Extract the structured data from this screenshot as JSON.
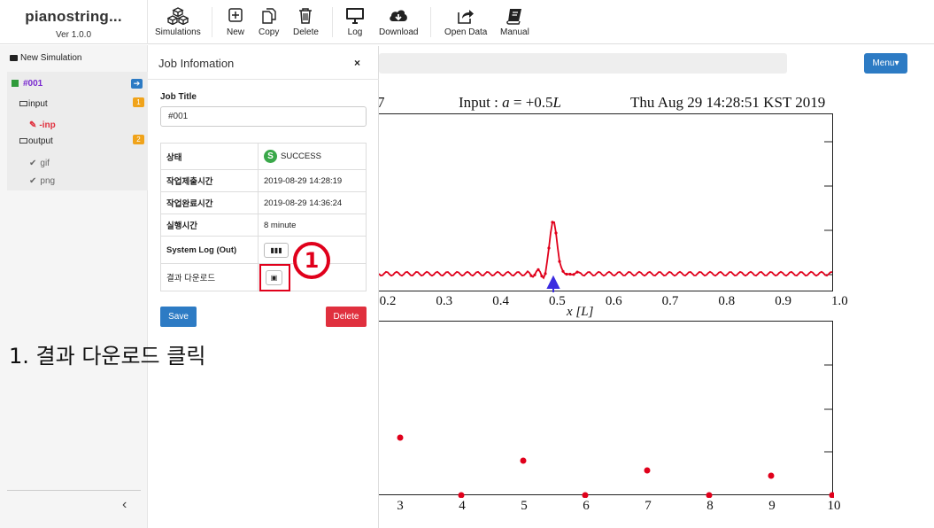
{
  "app": {
    "name": "pianostring...",
    "version": "Ver 1.0.0"
  },
  "toolbar": {
    "simulations": "Simulations",
    "new": "New",
    "copy": "Copy",
    "delete": "Delete",
    "log": "Log",
    "download": "Download",
    "open_data": "Open Data",
    "manual": "Manual"
  },
  "sidebar": {
    "new_simulation": "New Simulation",
    "job": "#001",
    "input": "input",
    "input_count": "1",
    "input_file": "-inp",
    "output": "output",
    "output_count": "2",
    "output_files": [
      "gif",
      "png"
    ]
  },
  "menu_label": "Menu",
  "plot": {
    "header_left": "Input : a = +0.5L",
    "header_right": "Thu Aug 29 14:28:51 KST 2019",
    "x_ticks_top": [
      "0.2",
      "0.3",
      "0.4",
      "0.5",
      "0.6",
      "0.7",
      "0.8",
      "0.9",
      "1.0"
    ],
    "x_label_top": "x [L]",
    "x_ticks_bottom": [
      "3",
      "4",
      "5",
      "6",
      "7",
      "8",
      "9",
      "10"
    ]
  },
  "modal": {
    "title": "Job Infomation",
    "close": "×",
    "job_title_label": "Job Title",
    "job_title_value": "#001",
    "rows": {
      "status_key": "상태",
      "status_value": "SUCCESS",
      "submit_key": "작업제출시간",
      "submit_value": "2019-08-29 14:28:19",
      "complete_key": "작업완료시간",
      "complete_value": "2019-08-29 14:36:24",
      "runtime_key": "실행시간",
      "runtime_value": "8 minute",
      "syslog_key": "System Log (Out)",
      "download_key": "결과 다운로드"
    },
    "save": "Save",
    "delete": "Delete"
  },
  "annotation": {
    "callout": "1",
    "instruction": "1. 결과 다운로드 클릭"
  },
  "colors": {
    "accent": "#2d7bc4",
    "danger": "#e0303e",
    "highlight": "#e0001b",
    "success": "#3aa84a",
    "job": "#7a2bd0"
  }
}
